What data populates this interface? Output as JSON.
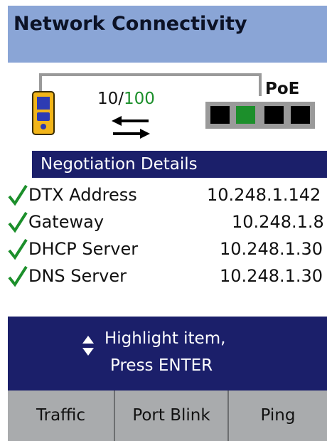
{
  "window": {
    "title": "Network Connectivity"
  },
  "link": {
    "speed_slow": "10/",
    "speed_fast": "100",
    "poe_label": "PoE",
    "ports": [
      "off",
      "active",
      "off",
      "off"
    ],
    "port_colors": {
      "active": "#1c8f2b",
      "off": "#000000"
    }
  },
  "details": {
    "header": "Negotiation Details",
    "rows": [
      {
        "label": "DTX Address",
        "value": "10.248.1.142",
        "status": "ok"
      },
      {
        "label": "Gateway",
        "value": "10.248.1.8",
        "status": "ok"
      },
      {
        "label": "DHCP Server",
        "value": "10.248.1.30",
        "status": "ok"
      },
      {
        "label": "DNS Server",
        "value": "10.248.1.30",
        "status": "ok"
      }
    ]
  },
  "prompt": {
    "icon": "up-down-arrows-icon",
    "line1": "Highlight item,",
    "line2": "Press ENTER"
  },
  "softkeys": {
    "traffic": "Traffic",
    "port_blink": "Port Blink",
    "ping": "Ping"
  },
  "colors": {
    "title_bar": "#8aa5d6",
    "accent_dark": "#1b1f6a",
    "softkey_bar": "#a9abad",
    "check_green": "#1c8f2b"
  }
}
